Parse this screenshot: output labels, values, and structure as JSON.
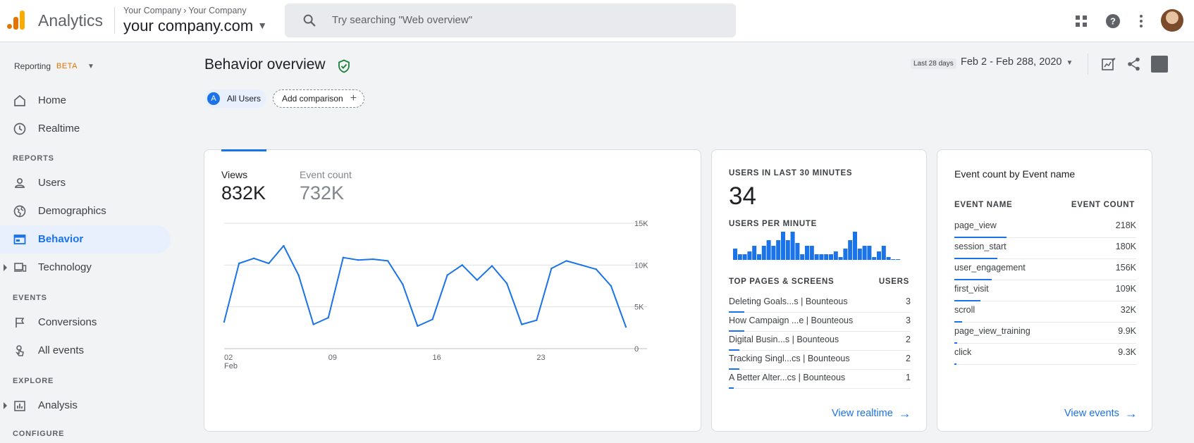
{
  "topbar": {
    "app_name": "Analytics",
    "breadcrumb": [
      "Your Company",
      "Your Company"
    ],
    "property": "your company.com",
    "search_placeholder": "Try searching \"Web overview\"",
    "icons": [
      "apps-icon",
      "help-icon",
      "more-vert-icon",
      "avatar"
    ]
  },
  "sidebar": {
    "reporting_label": "Reporting",
    "beta_label": "BETA",
    "home": "Home",
    "realtime": "Realtime",
    "reports_section": "REPORTS",
    "users": "Users",
    "demographics": "Demographics",
    "behavior": "Behavior",
    "technology": "Technology",
    "events_section": "EVENTS",
    "conversions": "Conversions",
    "all_events": "All events",
    "explore_section": "EXPLORE",
    "analysis": "Analysis",
    "configure_section": "CONFIGURE"
  },
  "header": {
    "title": "Behavior overview",
    "chip_all_letter": "A",
    "chip_all_users": "All Users",
    "add_comparison": "Add comparison",
    "date_small": "Last 28 days",
    "date_range": "Feb 2 - Feb 288, 2020"
  },
  "card_views": {
    "metric1_label": "Views",
    "metric1_value": "832K",
    "metric2_label": "Event count",
    "metric2_value": "732K"
  },
  "chart_data": {
    "type": "line",
    "x_tick_labels": [
      "02",
      "09",
      "16",
      "23"
    ],
    "x_tick_sublabel": "Feb",
    "y_tick_labels": [
      "15K",
      "10K",
      "5K",
      "0"
    ],
    "ylim": [
      0,
      15000
    ],
    "grid": true,
    "series": [
      {
        "values": [
          3200,
          10200,
          10800,
          10200,
          12300,
          8800,
          2900,
          3700,
          10900,
          10600,
          10700,
          10500,
          7700,
          2700,
          3500,
          8800,
          10000,
          8200,
          9900,
          7800,
          2900,
          3400,
          9600,
          10500,
          10000,
          9500,
          7500,
          2600
        ],
        "color": "#1a73e8"
      }
    ]
  },
  "card_realtime": {
    "users_label": "USERS IN LAST 30 MINUTES",
    "users_value": "34",
    "per_minute_label": "USERS PER MINUTE",
    "per_minute_values": [
      4,
      2,
      2,
      3,
      5,
      2,
      5,
      7,
      5,
      7,
      10,
      7,
      10,
      6,
      2,
      5,
      5,
      2,
      2,
      2,
      2,
      3,
      1,
      4,
      7,
      10,
      4,
      5,
      5,
      1,
      3,
      5,
      1,
      0,
      0
    ],
    "top_pages_label": "TOP PAGES & SCREENS",
    "users_col": "USERS",
    "rows": [
      {
        "name": "Deleting Goals...s | Bounteous",
        "value": "3",
        "share": 1.0
      },
      {
        "name": "How Campaign ...e | Bounteous",
        "value": "3",
        "share": 1.0
      },
      {
        "name": "Digital Busin...s | Bounteous",
        "value": "2",
        "share": 0.67
      },
      {
        "name": "Tracking Singl...cs | Bounteous",
        "value": "2",
        "share": 0.67
      },
      {
        "name": "A Better Alter...cs | Bounteous",
        "value": "1",
        "share": 0.33
      }
    ],
    "link": "View realtime"
  },
  "card_events": {
    "title": "Event count by Event name",
    "col_name": "EVENT NAME",
    "col_count": "EVENT COUNT",
    "rows": [
      {
        "name": "page_view",
        "value": "218K",
        "share": 1.0
      },
      {
        "name": "session_start",
        "value": "180K",
        "share": 0.83
      },
      {
        "name": "user_engagement",
        "value": "156K",
        "share": 0.72
      },
      {
        "name": "first_visit",
        "value": "109K",
        "share": 0.5
      },
      {
        "name": "scroll",
        "value": "32K",
        "share": 0.15
      },
      {
        "name": "page_view_training",
        "value": "9.9K",
        "share": 0.05
      },
      {
        "name": "click",
        "value": "9.3K",
        "share": 0.04
      }
    ],
    "link": "View events"
  },
  "colors": {
    "accent": "#1a73e8",
    "brand_orange": "#e37400",
    "verified_green": "#188038"
  }
}
